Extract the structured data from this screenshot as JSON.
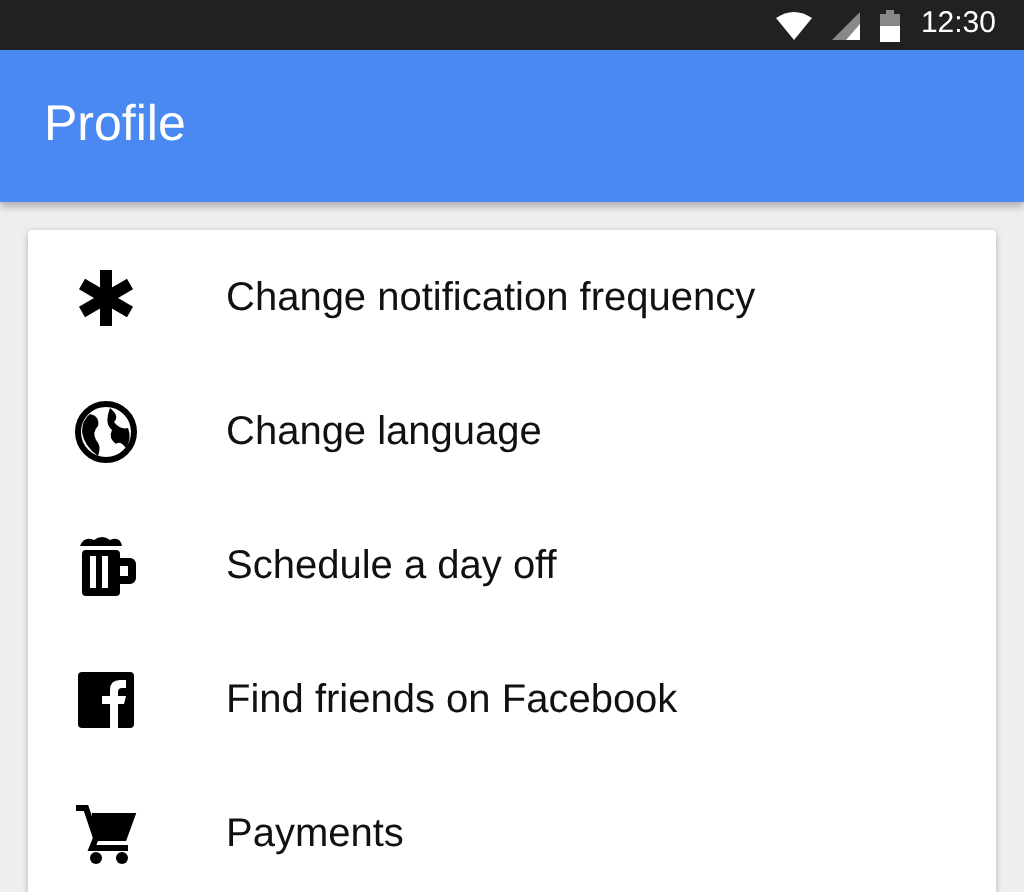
{
  "status_bar": {
    "time": "12:30"
  },
  "app_bar": {
    "title": "Profile"
  },
  "menu_items": [
    {
      "kind": "asterisk",
      "label": "Change notification frequency"
    },
    {
      "kind": "globe",
      "label": "Change language"
    },
    {
      "kind": "mug",
      "label": "Schedule a day off"
    },
    {
      "kind": "social",
      "label": "Find friends on Facebook"
    },
    {
      "kind": "cart",
      "label": "Payments"
    }
  ]
}
